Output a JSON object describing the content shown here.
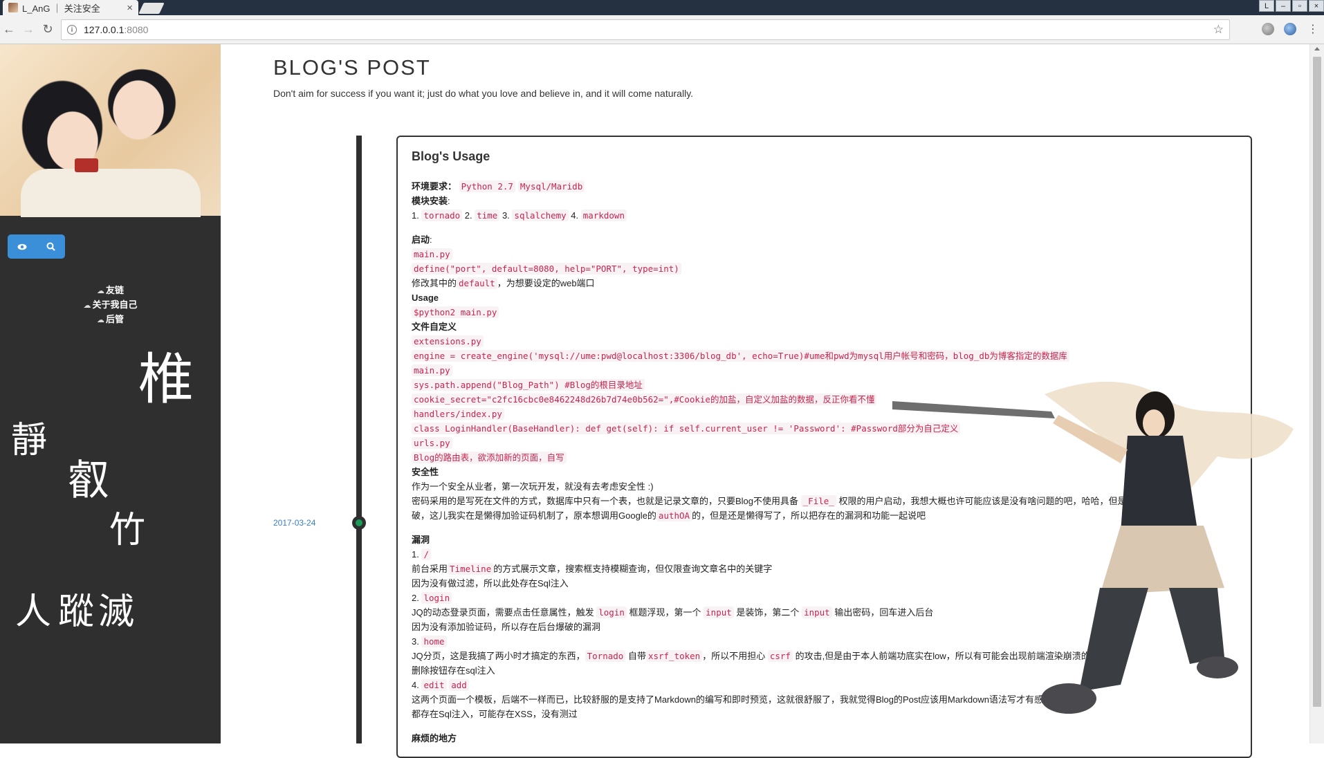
{
  "browser": {
    "tab_title": "L_AnG ｜ 关注安全",
    "tab_close": "×",
    "url_host": "127.0.0.1",
    "url_port": ":8080",
    "profile_letter": "L",
    "win_min": "–",
    "win_max": "▫",
    "win_close": "×",
    "back": "←",
    "forward": "→",
    "reload": "↻",
    "star": "☆",
    "menu": "⋮"
  },
  "sidebar": {
    "view_btn": "👁",
    "search_btn": "🔍",
    "links": [
      "友链",
      "关于我自己",
      "后管"
    ],
    "calligraphy": [
      "椎",
      "靜",
      "叡",
      "竹",
      "人",
      "蹤",
      "滅"
    ]
  },
  "main": {
    "title": "BLOG'S POST",
    "subtitle": "Don't aim for success if you want it; just do what you love and believe in, and it will come naturally."
  },
  "post": {
    "date": "2017-03-24",
    "title": "Blog's Usage",
    "env_label": "环境要求：",
    "env_items": [
      "Python 2.7",
      "Mysql/Maridb"
    ],
    "modules_label": "模块安装",
    "modules_colon": ":",
    "modules": [
      "tornado",
      "time",
      "sqlalchemy",
      "markdown"
    ],
    "start_label": "启动",
    "start_colon": ":",
    "start_code1": "main.py",
    "start_code2": "define(\"port\", default=8080, help=\"PORT\", type=int)",
    "start_text_pre": "修改其中的",
    "start_text_code": "default",
    "start_text_post": "，为想要设定的web端口",
    "usage_label": "Usage",
    "usage_code": "$python2 main.py",
    "custom_label": "文件自定义",
    "custom_lines": [
      "extensions.py",
      "engine = create_engine('mysql://ume:pwd@localhost:3306/blog_db', echo=True)#ume和pwd为mysql用户帐号和密码，blog_db为博客指定的数据库",
      "main.py",
      "sys.path.append(\"Blog_Path\") #Blog的根目录地址",
      "cookie_secret=\"c2fc16cbc0e8462248d26b7d74e0b562=\",#Cookie的加盐，自定义加盐的数据，反正你看不懂",
      "handlers/index.py",
      "class LoginHandler(BaseHandler): def get(self): if self.current_user != 'Password': #Password部分为自己定义",
      "urls.py",
      "Blog的路由表，欲添加新的页面，自写"
    ],
    "security_label": "安全性",
    "security_l1": "作为一个安全从业者，第一次玩开发，就没有去考虑安全性 :)",
    "security_l2_pre": "密码采用的是写死在文件的方式，数据库中只有一个表，也就是记录文章的，只要Blog不使用具备",
    "security_l2_code": "_File_",
    "security_l2_post": "权限的用户启动，我想大概也许可能应该是没有啥问题的吧，哈哈，但是后台可以爆",
    "security_l3_pre": "破，这儿我实在是懒得加验证码机制了，原本想调用Google的",
    "security_l3_code": "authOA",
    "security_l3_post": "的，但是还是懒得写了，所以把存在的漏洞和功能一起说吧",
    "vuln_label": "漏洞",
    "v1_num": "1.",
    "v1_code": "/",
    "v1_a_pre": "前台采用",
    "v1_a_code": "Timeline",
    "v1_a_post": "的方式展示文章，搜索框支持模糊查询，但仅限查询文章名中的关键字",
    "v1_b": "因为没有做过滤，所以此处存在Sql注入",
    "v2_num": "2.",
    "v2_code": "login",
    "v2_a_pre": "JQ的动态登录页面，需要点击任意属性，触发",
    "v2_a_code1": "login",
    "v2_a_mid1": "框题浮现，第一个",
    "v2_a_code2": "input",
    "v2_a_mid2": "是装饰，第二个",
    "v2_a_code3": "input",
    "v2_a_post": "输出密码，回车进入后台",
    "v2_b": "因为没有添加验证码，所以存在后台爆破的漏洞",
    "v3_num": "3.",
    "v3_code": "home",
    "v3_a_pre": "JQ分页，这是我搞了两小时才搞定的东西，",
    "v3_a_code1": "Tornado",
    "v3_a_mid1": "自带",
    "v3_a_code2": "xsrf_token",
    "v3_a_mid2": "，所以不用担心",
    "v3_a_code3": "csrf",
    "v3_a_post": "的攻击,但是由于本人前端功底实在low，所以有可能会出现前端渲染崩溃的问题",
    "v3_b": "删除按钮存在sql注入",
    "v4_num": "4.",
    "v4_code1": "edit",
    "v4_code2": "add",
    "v4_a": "这两个页面一个模板，后端不一样而已，比较舒服的是支持了Markdown的编写和即时预览，这就很舒服了，我就觉得Blog的Post应该用Markdown语法写才有感觉",
    "v4_b": "都存在Sql注入，可能存在XSS，没有测过",
    "next_label": "麻烦的地方"
  }
}
